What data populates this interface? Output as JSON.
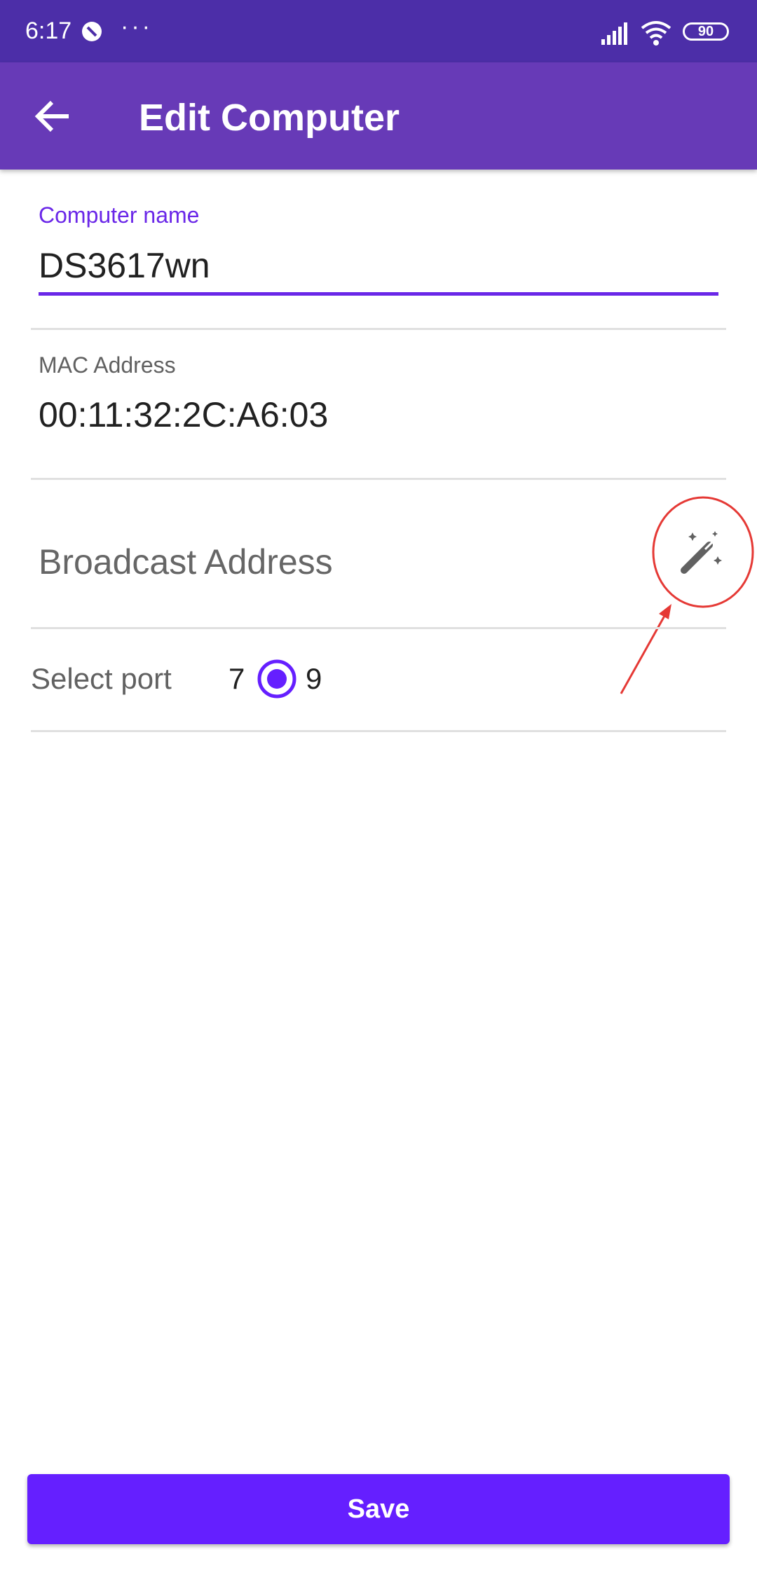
{
  "status_bar": {
    "time": "6:17",
    "dots": "···",
    "battery": "90",
    "icons": [
      "dnd-icon",
      "signal-icon",
      "wifi-icon",
      "battery-icon"
    ]
  },
  "app_bar": {
    "title": "Edit Computer",
    "back_icon": "arrow-back-icon",
    "color": "#673ab7"
  },
  "form": {
    "computer_name": {
      "label": "Computer name",
      "value": "DS3617wn"
    },
    "mac_address": {
      "label": "MAC Address",
      "value": "00:11:32:2C:A6:03"
    },
    "broadcast_address": {
      "placeholder": "Broadcast Address",
      "action_icon": "magic-wand-icon"
    },
    "port": {
      "label": "Select port",
      "options": [
        "7",
        "9"
      ],
      "selected": "9"
    }
  },
  "save_label": "Save",
  "colors": {
    "accent": "#651fff",
    "status_bar": "#4c2ea8",
    "annotation": "#e53935"
  }
}
